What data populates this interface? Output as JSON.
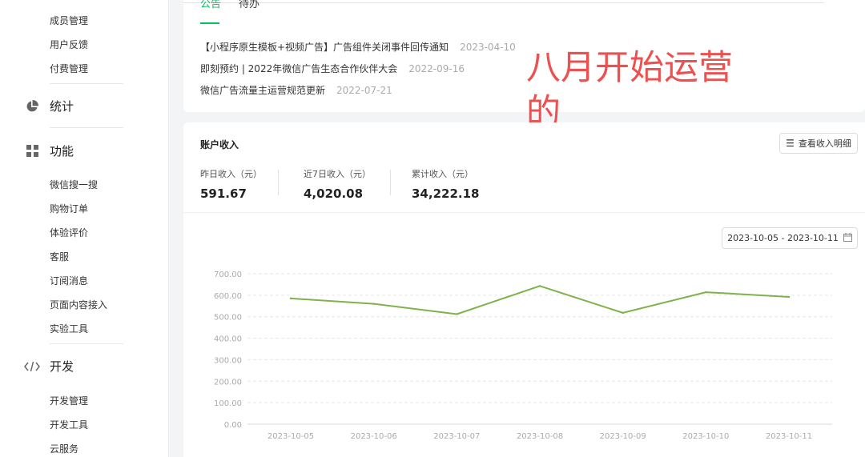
{
  "sidebar": {
    "top_items": [
      "成员管理",
      "用户反馈",
      "付费管理"
    ],
    "stats_label": "统计",
    "features_label": "功能",
    "feature_items": [
      "微信搜一搜",
      "购物订单",
      "体验评价",
      "客服",
      "订阅消息",
      "页面内容接入",
      "实验工具"
    ],
    "dev_label": "开发",
    "dev_items": [
      "开发管理",
      "开发工具",
      "云服务"
    ]
  },
  "notice": {
    "tabs": [
      "公告",
      "待办"
    ],
    "items": [
      {
        "title": "【小程序原生模板+视频广告】广告组件关闭事件回传通知",
        "date": "2023-04-10"
      },
      {
        "title": "即刻预约 | 2022年微信广告生态合作伙伴大会",
        "date": "2022-09-16"
      },
      {
        "title": "微信广告流量主运营规范更新",
        "date": "2022-07-21"
      }
    ]
  },
  "annotation": "八月开始运营的",
  "income": {
    "title": "账户收入",
    "detail_button": "查看收入明细",
    "stats": [
      {
        "label": "昨日收入（元）",
        "value": "591.67"
      },
      {
        "label": "近7日收入（元）",
        "value": "4,020.08"
      },
      {
        "label": "累计收入（元）",
        "value": "34,222.18"
      }
    ],
    "date_range": "2023-10-05 - 2023-10-11"
  },
  "colors": {
    "accent": "#07c160",
    "line": "#7fb24a",
    "annotation": "#ee4f4f"
  },
  "chart_data": {
    "type": "line",
    "categories": [
      "2023-10-05",
      "2023-10-06",
      "2023-10-07",
      "2023-10-08",
      "2023-10-09",
      "2023-10-10",
      "2023-10-11"
    ],
    "series": [
      {
        "values": [
          585,
          560,
          512,
          643,
          518,
          614,
          592
        ]
      }
    ],
    "ylim": [
      0,
      700
    ],
    "yticks": [
      "0.00",
      "100.00",
      "200.00",
      "300.00",
      "400.00",
      "500.00",
      "600.00",
      "700.00"
    ],
    "grid": true
  }
}
